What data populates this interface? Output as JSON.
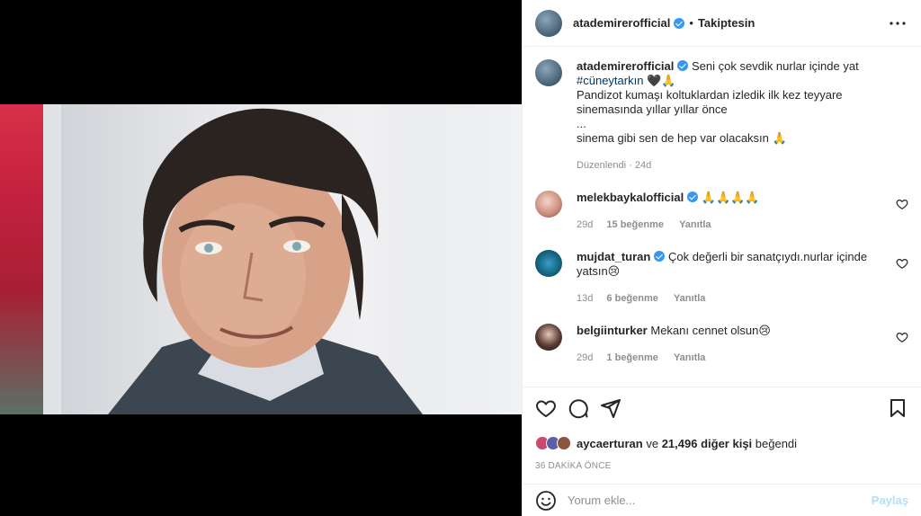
{
  "header": {
    "username": "atademirerofficial",
    "separator": "•",
    "follow_label": "Takiptesin"
  },
  "caption": {
    "username": "atademirerofficial",
    "text_line1": "Seni çok sevdik nurlar içinde yat",
    "hashtag": "#cüneytarkın",
    "emoji_line1": "🖤🙏",
    "text_line2": "Pandizot kumaşı koltuklardan izledik ilk kez teyyare sinemasında yıllar yıllar önce",
    "text_line3": "...",
    "text_line4": "sinema gibi sen de hep var olacaksın 🙏",
    "edited": "Düzenlendi",
    "time": "24d"
  },
  "comments": [
    {
      "username": "melekbaykalofficial",
      "verified": true,
      "text": "🙏🙏🙏🙏",
      "time": "29d",
      "likes": "15 beğenme",
      "reply": "Yanıtla"
    },
    {
      "username": "mujdat_turan",
      "verified": true,
      "text": "Çok değerli bir sanatçıydı.nurlar içinde yatsın😢",
      "time": "13d",
      "likes": "6 beğenme",
      "reply": "Yanıtla"
    },
    {
      "username": "belgiinturker",
      "verified": false,
      "text": "Mekanı cennet olsun😢",
      "time": "29d",
      "likes": "1 beğenme",
      "reply": "Yanıtla"
    }
  ],
  "likes": {
    "liked_by": "aycaerturan",
    "and": "ve",
    "others": "21,496 diğer kişi",
    "suffix": "beğendi"
  },
  "posted_time": "36 DAKİKA ÖNCE",
  "add_comment": {
    "placeholder": "Yorum ekle...",
    "post_label": "Paylaş"
  },
  "colors": {
    "verified": "#3897f0",
    "hashtag": "#00376b",
    "muted": "#8e8e8e",
    "post_disabled": "#b2dffc"
  }
}
